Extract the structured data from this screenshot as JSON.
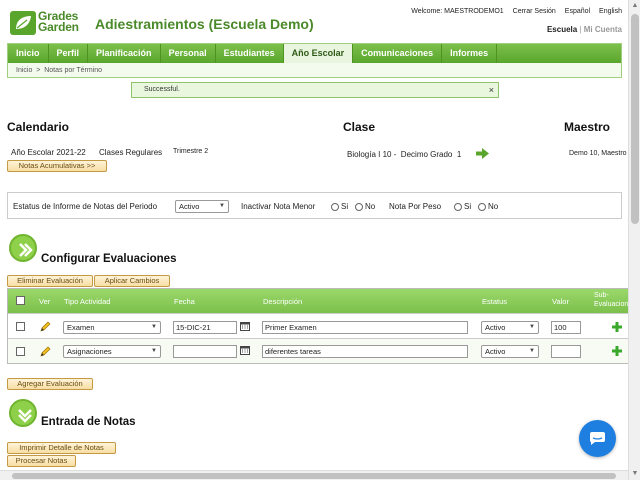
{
  "header": {
    "logo_line1": "Grades",
    "logo_line2": "Garden",
    "app_title": "Adiestramientos (Escuela Demo)",
    "welcome": "Welcome: MAESTRODEMO1",
    "logout": "Cerrar Sesión",
    "lang_es": "Español",
    "lang_en": "English",
    "school": "Escuela",
    "sep": "|",
    "my_account": "Mi Cuenta"
  },
  "nav": {
    "tabs": [
      "Inicio",
      "Perfil",
      "Planificación",
      "Personal",
      "Estudiantes",
      "Año Escolar",
      "Comunicaciones",
      "Informes"
    ],
    "active_tab": "Año Escolar",
    "breadcrumb": "Inicio  >  Notas por Término"
  },
  "message": {
    "text": "Successful.",
    "close": "×"
  },
  "calendario": {
    "title": "Calendario",
    "year": "Año Escolar 2021-22",
    "classes": "Clases Regulares",
    "term": "Trimestre 2",
    "notes_button": "Notas Acumulativas >>"
  },
  "clase": {
    "title": "Clase",
    "name": "Biología I 10 -  Decimo Grado  1"
  },
  "maestro": {
    "title": "Maestro",
    "name": "Demo 10, Maestro"
  },
  "filter": {
    "status_label": "Estatus de Informe de Notas del Periodo",
    "status_value": "Activo",
    "inactivate_label": "Inactivar Nota Menor",
    "by_weight_label": "Nota Por Peso",
    "yes": "Si",
    "no": "No"
  },
  "config": {
    "title": "Configurar Evaluaciones",
    "delete_button": "Eliminar Evaluación",
    "apply_button": "Aplicar Cambios",
    "add_button": "Agregar Evaluación",
    "columns": {
      "ver": "Ver",
      "tipo": "Tipo Actividad",
      "fecha": "Fecha",
      "descripcion": "Descripción",
      "estatus": "Estatus",
      "valor": "Valor",
      "sub": "Sub-\nEvaluacion"
    },
    "rows": [
      {
        "tipo": "Examen",
        "fecha": "15-DIC-21",
        "descripcion": "Primer Examen",
        "estatus": "Activo",
        "valor": "100"
      },
      {
        "tipo": "Asignaciones",
        "fecha": "",
        "descripcion": "diferentes tareas",
        "estatus": "Activo",
        "valor": ""
      }
    ]
  },
  "entrada": {
    "title": "Entrada de Notas",
    "print_button": "Imprimir Detalle de Notas",
    "process_button": "Procesar Notas"
  },
  "colors": {
    "brand_green": "#5aa62d",
    "header_green": "#7cc04b",
    "chat_blue": "#1e7fe0"
  }
}
